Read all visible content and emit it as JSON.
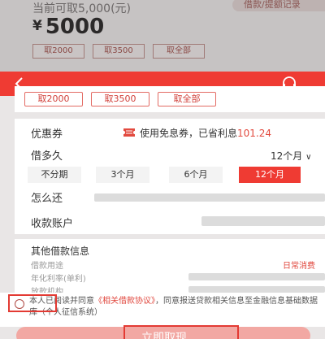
{
  "background_page": {
    "available_text": "当前可取5,000(元)",
    "records_link": "借款/提额记录",
    "amount_yen": "¥",
    "amount": "5000",
    "buttons": [
      "取2000",
      "取3500",
      "取全部"
    ]
  },
  "amount_chips": [
    "取2000",
    "取3500",
    "取全部"
  ],
  "coupon": {
    "label": "优惠券",
    "text_prefix": "使用免息券，已省利息",
    "saved_amount": "101.24"
  },
  "term": {
    "label": "借多久",
    "selected": "12个月",
    "options": [
      "不分期",
      "3个月",
      "6个月",
      "12个月"
    ],
    "active_index": 3
  },
  "repay": {
    "label": "怎么还"
  },
  "account": {
    "label": "收款账户"
  },
  "other_info": {
    "title": "其他借款信息",
    "rows": [
      {
        "label": "借款用途",
        "value": "日常消费"
      },
      {
        "label": "年化利率(单利)",
        "value": ""
      },
      {
        "label": "放款机构",
        "value": ""
      }
    ]
  },
  "agreement": {
    "prefix": "本人已阅读并同意",
    "link": "《相关借款协议》",
    "suffix": "，同意报送贷款相关信息至金融信息基础数据库（个人征信系统）"
  },
  "submit": {
    "label": "立即取现"
  },
  "colors": {
    "primary": "#ef3b33",
    "link": "#e0463c"
  },
  "icons": {
    "back": "back-arrow-icon",
    "service": "customer-service-icon",
    "coupon": "coupon-ticket-icon"
  }
}
